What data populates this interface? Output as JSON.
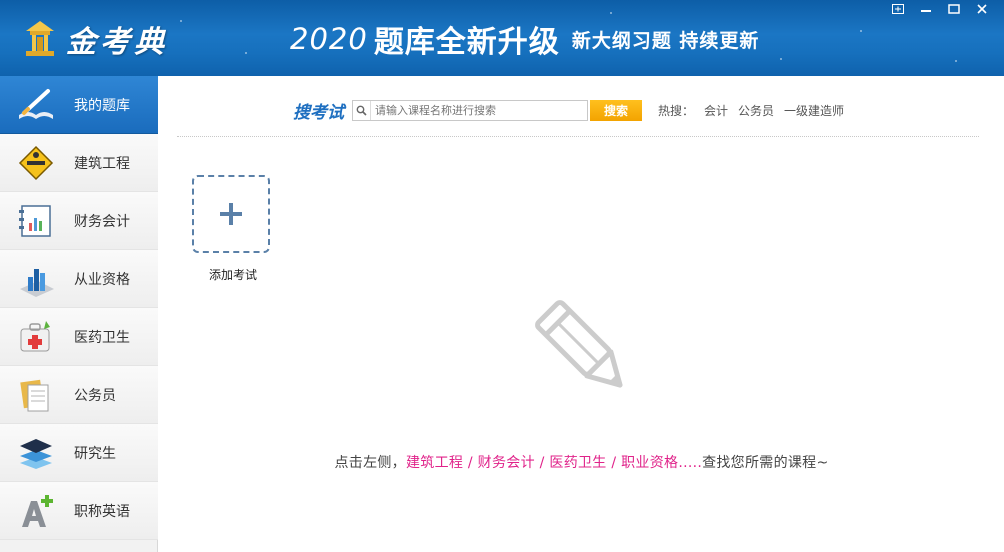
{
  "app": {
    "logo_text": "金考典",
    "banner_year": "2020",
    "banner_main": "题库全新升级",
    "banner_sub": "新大纲习题 持续更新"
  },
  "window_controls": [
    {
      "name": "restore-icon"
    },
    {
      "name": "minimize-icon"
    },
    {
      "name": "maximize-icon"
    },
    {
      "name": "close-icon"
    }
  ],
  "sidebar": {
    "items": [
      {
        "label": "我的题库",
        "icon": "pen-book-icon",
        "active": true
      },
      {
        "label": "建筑工程",
        "icon": "construction-sign-icon",
        "active": false
      },
      {
        "label": "财务会计",
        "icon": "ledger-chart-icon",
        "active": false
      },
      {
        "label": "从业资格",
        "icon": "bar-chart-icon",
        "active": false
      },
      {
        "label": "医药卫生",
        "icon": "medical-kit-icon",
        "active": false
      },
      {
        "label": "公务员",
        "icon": "document-folder-icon",
        "active": false
      },
      {
        "label": "研究生",
        "icon": "layers-icon",
        "active": false
      },
      {
        "label": "职称英语",
        "icon": "letter-a-plus-icon",
        "active": false
      }
    ]
  },
  "search": {
    "title": "搜考试",
    "placeholder": "请输入课程名称进行搜索",
    "button_label": "搜索",
    "hot_label": "热搜：",
    "hot_items": [
      "会计",
      "公务员",
      "一级建造师"
    ]
  },
  "main": {
    "add_exam_label": "添加考试",
    "hint_prefix": "点击左侧，",
    "hint_links": "建筑工程 / 财务会计 / 医药卫生 / 职业资格.....",
    "hint_suffix": "查找您所需的课程~"
  },
  "colors": {
    "titlebar": "#1670bd",
    "active_item": "#1a6cbd",
    "search_title": "#1e6fc0",
    "search_button": "#f3a300",
    "hint_link": "#e0238a"
  }
}
